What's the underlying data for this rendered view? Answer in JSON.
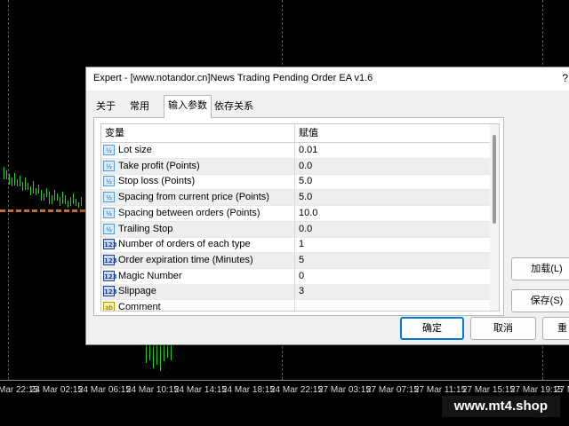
{
  "chart": {
    "time_labels": [
      "Mar 22:15",
      "24 Mar 02:15",
      "24 Mar 06:15",
      "24 Mar 10:15",
      "24 Mar 14:15",
      "24 Mar 18:15",
      "24 Mar 22:15",
      "27 Mar 03:15",
      "27 Mar 07:15",
      "27 Mar 11:15",
      "27 Mar 15:15",
      "27 Mar 19:15",
      "27 Mar 23"
    ],
    "watermark": "www.mt4.shop",
    "colors": {
      "background": "#000000",
      "candle": "#22d022",
      "level_line": "#c07030"
    }
  },
  "dialog": {
    "title": "Expert - [www.notandor.cn]News Trading Pending Order EA v1.6",
    "help": "?",
    "tabs": [
      {
        "label": "关于",
        "active": false
      },
      {
        "label": "常用",
        "active": false
      },
      {
        "label": "输入参数",
        "active": true
      },
      {
        "label": "依存关系",
        "active": false
      }
    ],
    "grid": {
      "headers": {
        "variable": "变量",
        "value": "赋值"
      },
      "rows": [
        {
          "icon": "real-type-icon",
          "icon_text": "½",
          "name": "Lot size",
          "value": "0.01"
        },
        {
          "icon": "real-type-icon",
          "icon_text": "½",
          "name": "Take profit (Points)",
          "value": "0.0"
        },
        {
          "icon": "real-type-icon",
          "icon_text": "½",
          "name": "Stop loss (Points)",
          "value": "5.0"
        },
        {
          "icon": "real-type-icon",
          "icon_text": "½",
          "name": "Spacing from current price (Points)",
          "value": "5.0"
        },
        {
          "icon": "real-type-icon",
          "icon_text": "½",
          "name": "Spacing between orders (Points)",
          "value": "10.0"
        },
        {
          "icon": "real-type-icon",
          "icon_text": "½",
          "name": "Trailing Stop",
          "value": "0.0"
        },
        {
          "icon": "int-type-icon",
          "icon_text": "123",
          "name": "Number of orders of each type",
          "value": "1"
        },
        {
          "icon": "int-type-icon",
          "icon_text": "123",
          "name": "Order expiration time (Minutes)",
          "value": "5"
        },
        {
          "icon": "int-type-icon",
          "icon_text": "123",
          "name": "Magic Number",
          "value": "0"
        },
        {
          "icon": "int-type-icon",
          "icon_text": "123",
          "name": "Slippage",
          "value": "3"
        },
        {
          "icon": "string-type-icon",
          "icon_text": "ab",
          "name": "Comment",
          "value": ""
        }
      ]
    },
    "buttons": {
      "load": "加载(L)",
      "save": "保存(S)",
      "ok": "确定",
      "cancel": "取消",
      "reset": "重"
    }
  }
}
